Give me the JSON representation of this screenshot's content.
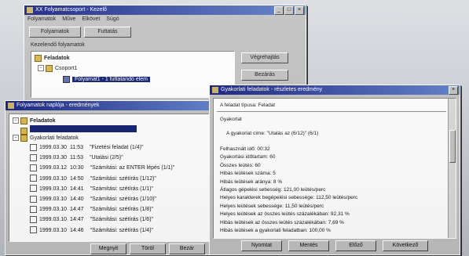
{
  "window1": {
    "title": "ⅩⅩ Folyamatcsoport - Kezelő",
    "menu": [
      "Folyamatok",
      "Műve",
      "Elkövet",
      "Súgó"
    ],
    "toolbar": {
      "tab_a": "Folyamatok",
      "tab_b": "Futtatás"
    },
    "section_label": "Kezelendő folyamatok",
    "tree": {
      "root": "Feladatok",
      "group": "Csoport1",
      "selected_item": "Folyamat1 - 1 futtatandó elem"
    },
    "buttons": {
      "run": "Végrehajtás",
      "close": "Bezárás"
    }
  },
  "window2": {
    "title": "Folyamatok naplója - eredmények",
    "tree": {
      "root": "Feladatok",
      "selected_item": "",
      "group": "Gyakorlati feladatok",
      "entries": [
        {
          "date": "1999.03.30",
          "time": "11:53",
          "text": "\"Fizetési feladat (1/4)\""
        },
        {
          "date": "1999.03.30",
          "time": "11:53",
          "text": "\"Utalási (2/5)\""
        },
        {
          "date": "1999.03.12",
          "time": "10:30",
          "text": "\"Számítási: az ENTER lépés (1/1)\""
        },
        {
          "date": "1999.03.10",
          "time": "14:50",
          "text": "\"Számítási: szétírás (1/12)\""
        },
        {
          "date": "1999.03.10",
          "time": "14:41",
          "text": "\"Számítási: szétírás (1/1)\""
        },
        {
          "date": "1999.03.10",
          "time": "14:40",
          "text": "\"Számítási: szétírás (1/10)\""
        },
        {
          "date": "1999.03.10",
          "time": "14:47",
          "text": "\"Számítási: szétírás (1/8)\""
        },
        {
          "date": "1999.03.10",
          "time": "14:47",
          "text": "\"Számítási: szétírás (1/6)\""
        },
        {
          "date": "1999.03.10",
          "time": "14:46",
          "text": "\"Számítási: szétírás (1/4)\""
        }
      ]
    },
    "buttons": {
      "open": "Megnyit",
      "delete": "Töröl",
      "close": "Bezár"
    }
  },
  "window3": {
    "title": "Gyakorlati feladatok - részletes eredmény",
    "header_line": "A feladat típusa: Feladat",
    "section": "Gyakorlat",
    "summary": "A gyakorlat címe: \"Utalás az (6/12)\"   (6/1)",
    "details": [
      "Felhasznált idő: 00:32",
      "Gyakorlási időtartam: 60",
      "Összes leütés: 60",
      "Hibás leütések száma: 5",
      "Hibás leütések aránya: 8 %",
      "Átlagos gépelési sebesség: 121,00 leütés/perc",
      "Helyes karakterek begépelési sebessége: 112,50 leütés/perc",
      "Helyes leütések sebessége: 11,50 leütés/perc",
      "Helyes leütések az összes leütés százalékában: 92,31 %",
      "Hibás leütések az összes leütés százalékában: 7,69 %",
      "Hibás leütések a gyakorlati feladatban: 100,00 %"
    ],
    "buttons": {
      "print": "Nyomtat",
      "save": "Mentés",
      "prev": "Előző",
      "next": "Következő"
    }
  },
  "colors": {
    "titlebar": "#101a7a",
    "selection": "#0b1a6e",
    "face": "#c0c0c0"
  }
}
